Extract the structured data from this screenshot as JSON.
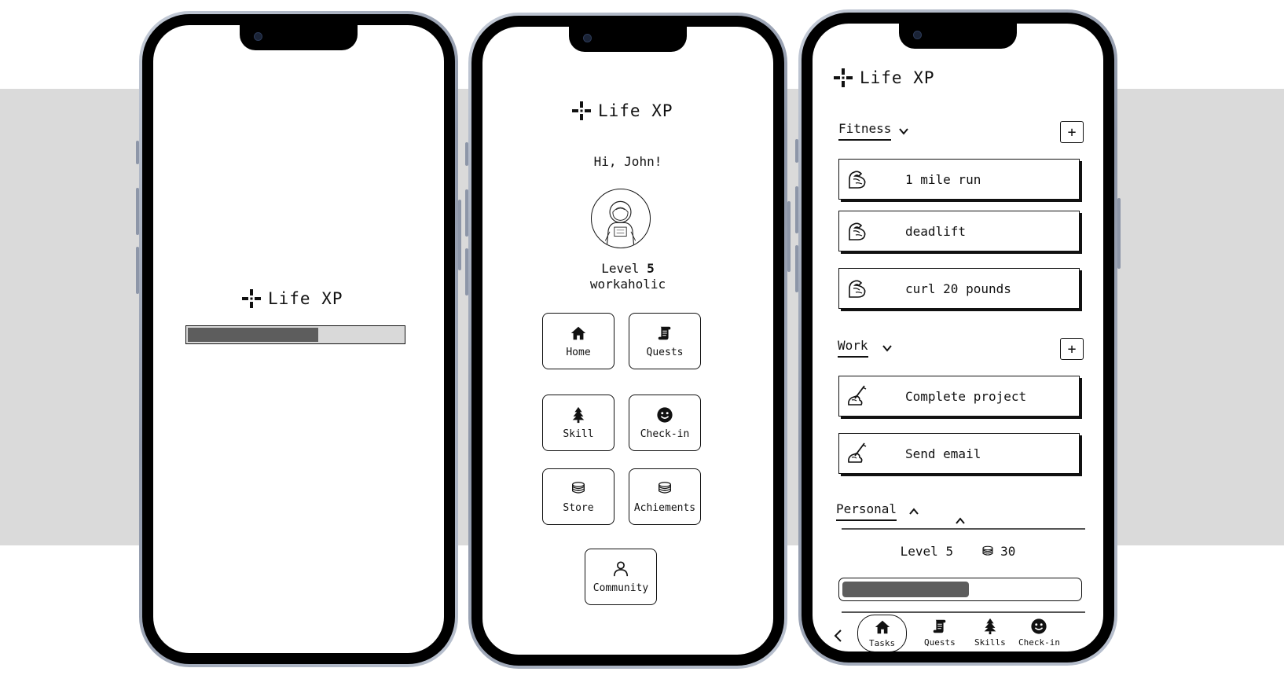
{
  "app": {
    "name": "Life XP"
  },
  "splash": {
    "logo_text": "Life XP",
    "loading_progress": 0.61
  },
  "home": {
    "logo_text": "Life XP",
    "greeting": "Hi, John!",
    "level_prefix": "Level",
    "level_value": "5",
    "title": "workaholic",
    "menu": [
      {
        "label": "Home",
        "icon": "house-icon"
      },
      {
        "label": "Quests",
        "icon": "scroll-icon"
      },
      {
        "label": "Skill",
        "icon": "tree-icon"
      },
      {
        "label": "Check-in",
        "icon": "smiley-icon"
      },
      {
        "label": "Store",
        "icon": "coins-icon"
      },
      {
        "label": "Achiements",
        "icon": "coins-icon"
      },
      {
        "label": "Community",
        "icon": "person-icon"
      }
    ]
  },
  "tasks": {
    "logo_text": "Life XP",
    "sections": [
      {
        "name": "Fitness",
        "expanded": true,
        "add_label": "+",
        "items": [
          {
            "label": "1 mile run",
            "icon": "flexed-arm-icon"
          },
          {
            "label": "deadlift",
            "icon": "flexed-arm-icon"
          },
          {
            "label": "curl 20 pounds",
            "icon": "flexed-arm-icon"
          }
        ]
      },
      {
        "name": "Work",
        "expanded": true,
        "add_label": "+",
        "items": [
          {
            "label": "Complete project",
            "icon": "writing-hand-icon"
          },
          {
            "label": "Send email",
            "icon": "writing-hand-icon"
          }
        ]
      },
      {
        "name": "Personal",
        "expanded": false,
        "items": []
      }
    ],
    "status": {
      "level_text": "Level 5",
      "coins": "30",
      "xp_progress": 0.55
    },
    "tabs": [
      {
        "label": "Tasks",
        "icon": "house-icon",
        "active": true
      },
      {
        "label": "Quests",
        "icon": "scroll-icon",
        "active": false
      },
      {
        "label": "Skills",
        "icon": "tree-icon",
        "active": false
      },
      {
        "label": "Check-in",
        "icon": "smiley-icon",
        "active": false
      }
    ]
  },
  "colors": {
    "band": "#dadada",
    "progress_fill": "#5d5d5d",
    "progress_track": "#d9d9d9",
    "ink": "#111111"
  }
}
